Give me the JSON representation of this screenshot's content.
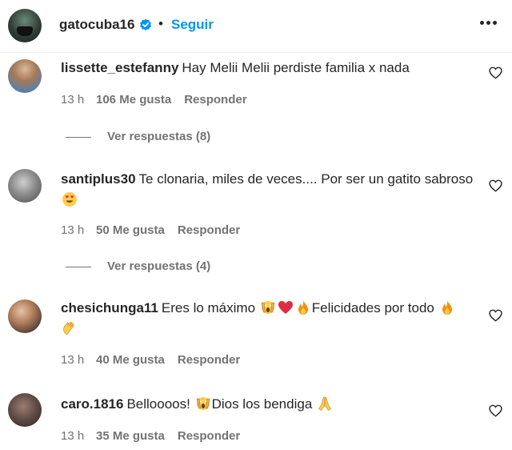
{
  "header": {
    "username": "gatocuba16",
    "verified": true,
    "separator": "•",
    "follow_label": "Seguir"
  },
  "comments": [
    {
      "username": "lissette_estefanny",
      "text": "Hay Melii Melii perdiste familia x nada",
      "time": "13 h",
      "likes": "106 Me gusta",
      "reply_label": "Responder",
      "view_replies": "Ver respuestas (8)"
    },
    {
      "username": "santiplus30",
      "text": "Te clonaria, miles de veces.... Por ser un gatito sabroso",
      "emoji_suffix": "heart-eyes-emoji",
      "time": "13 h",
      "likes": "50 Me gusta",
      "reply_label": "Responder",
      "view_replies": "Ver respuestas (4)"
    },
    {
      "username": "chesichunga11",
      "text_a": "Eres lo máximo",
      "text_b": "Felicidades por todo",
      "emojis": [
        "screaming-face-emoji",
        "red-heart-emoji",
        "fire-emoji",
        "fire-emoji",
        "clapping-hands-emoji"
      ],
      "time": "13 h",
      "likes": "40 Me gusta",
      "reply_label": "Responder"
    },
    {
      "username": "caro.1816",
      "text_a": "Belloooos!",
      "text_b": "Dios los bendiga",
      "emojis": [
        "screaming-face-emoji",
        "folded-hands-emoji"
      ],
      "time": "13 h",
      "likes": "35 Me gusta",
      "reply_label": "Responder"
    }
  ],
  "colors": {
    "text": "#262626",
    "secondary": "#737373",
    "link_blue": "#0095f6",
    "verified_blue": "#0095f6"
  }
}
